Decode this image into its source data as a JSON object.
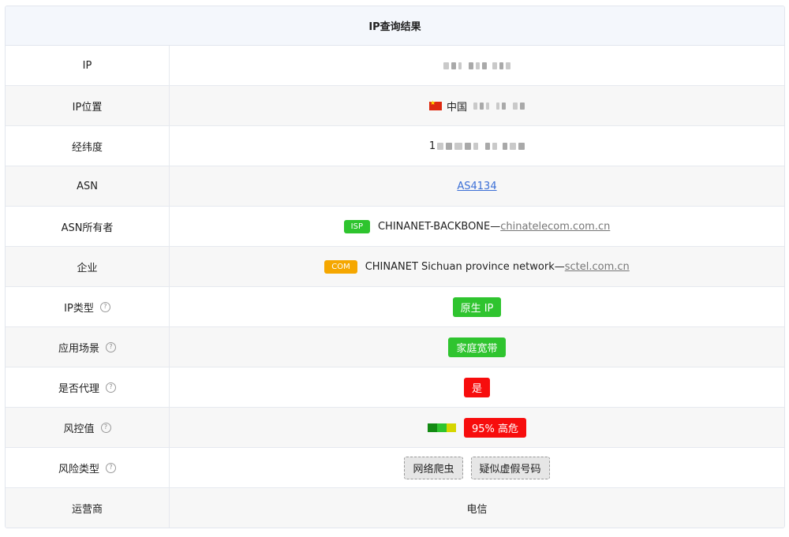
{
  "header": {
    "title": "IP查询结果"
  },
  "rows": {
    "ip": {
      "label": "IP"
    },
    "location": {
      "label": "IP位置",
      "country": "中国",
      "country_flag": "cn-flag-icon"
    },
    "coords": {
      "label": "经纬度",
      "visible_prefix": "1"
    },
    "asn": {
      "label": "ASN",
      "value": "AS4134"
    },
    "asn_owner": {
      "label": "ASN所有者",
      "tag": "ISP",
      "name": "CHINANET-BACKBONE",
      "separator": "—",
      "domain": "chinatelecom.com.cn"
    },
    "company": {
      "label": "企业",
      "tag": "COM",
      "name": "CHINANET Sichuan province network",
      "separator": "—",
      "domain": "sctel.com.cn"
    },
    "ip_type": {
      "label": "IP类型",
      "value": "原生 IP",
      "help": "?"
    },
    "scene": {
      "label": "应用场景",
      "value": "家庭宽带",
      "help": "?"
    },
    "proxy": {
      "label": "是否代理",
      "value": "是",
      "help": "?"
    },
    "risk": {
      "label": "风控值",
      "value": "95% 高危",
      "help": "?",
      "level_percent": 95,
      "bar_colors": [
        "#138a13",
        "#2fc42f",
        "#d6d600"
      ]
    },
    "risk_types": {
      "label": "风险类型",
      "help": "?",
      "items": [
        "网络爬虫",
        "疑似虚假号码"
      ]
    },
    "carrier": {
      "label": "运营商",
      "value": "电信"
    }
  },
  "colors": {
    "accent_link": "#3b6fd6",
    "green": "#2fc42f",
    "red": "#f70d0d",
    "orange": "#f5a700"
  }
}
